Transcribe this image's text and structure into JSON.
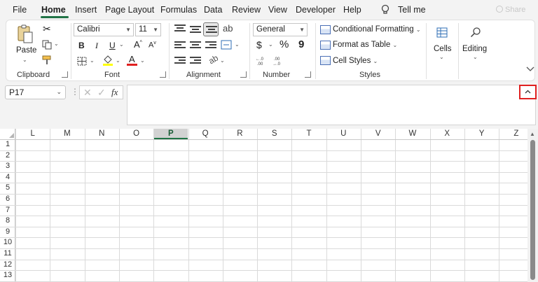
{
  "menu": {
    "tabs": [
      "File",
      "Home",
      "Insert",
      "Page Layout",
      "Formulas",
      "Data",
      "Review",
      "View",
      "Developer",
      "Help"
    ],
    "tell_me": "Tell me",
    "share": "Share"
  },
  "ribbon": {
    "clipboard": {
      "paste": "Paste",
      "label": "Clipboard"
    },
    "font": {
      "family": "Calibri",
      "size": "11",
      "bold": "B",
      "italic": "I",
      "underline": "U",
      "grow": "A",
      "shrink": "A",
      "color": "A",
      "label": "Font"
    },
    "alignment": {
      "label": "Alignment"
    },
    "number": {
      "format": "General",
      "currency": "$",
      "percent": "%",
      "comma": "9",
      "label": "Number"
    },
    "styles": {
      "conditional": "Conditional Formatting",
      "table": "Format as Table",
      "cell_styles": "Cell Styles",
      "label": "Styles"
    },
    "cells": {
      "label": "Cells"
    },
    "editing": {
      "label": "Editing"
    }
  },
  "formula_bar": {
    "name_box": "P17",
    "fx": "fx",
    "value": ""
  },
  "grid": {
    "columns": [
      "L",
      "M",
      "N",
      "O",
      "P",
      "Q",
      "R",
      "S",
      "T",
      "U",
      "V",
      "W",
      "X",
      "Y",
      "Z"
    ],
    "selected_column": "P",
    "rows": [
      "1",
      "2",
      "3",
      "4",
      "5",
      "6",
      "7",
      "8",
      "9",
      "10",
      "11",
      "12",
      "13"
    ]
  },
  "colors": {
    "accent": "#217346",
    "highlight": "#e02020",
    "font_color_bar": "#e02020",
    "fill_color_bar": "#ffff00"
  }
}
